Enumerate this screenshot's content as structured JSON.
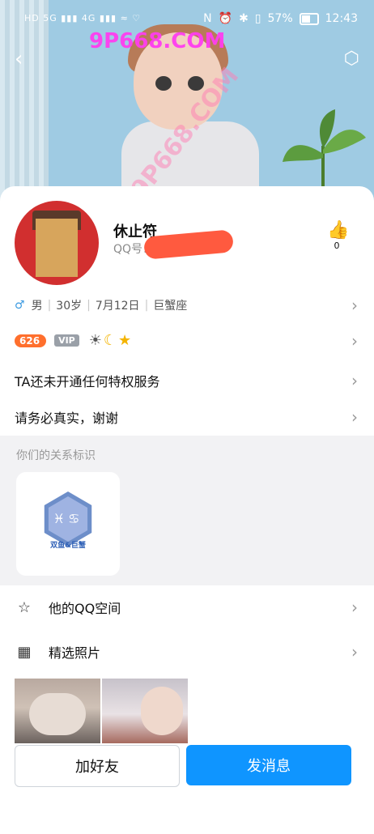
{
  "status_bar": {
    "battery": "57%",
    "time": "12:43"
  },
  "watermark": "9P668.COM",
  "profile": {
    "name": "休止符",
    "qq_label": "QQ号：",
    "likes": "0"
  },
  "info": {
    "gender_icon": "♂",
    "gender": "男",
    "age": "30岁",
    "birthday": "7月12日",
    "sign": "巨蟹座"
  },
  "badges": {
    "level": "626",
    "vip": "VIP"
  },
  "privilege_text": "TA还未开通任何特权服务",
  "bio": "请务必真实，谢谢",
  "relation": {
    "title": "你们的关系标识",
    "badge_label": "双鱼&巨蟹"
  },
  "links": {
    "qzone": "他的QQ空间",
    "photos": "精选照片"
  },
  "buttons": {
    "add_friend": "加好友",
    "send_message": "发消息"
  },
  "colors": {
    "primary_blue": "#0f95ff",
    "accent_orange": "#ff6f2d"
  }
}
